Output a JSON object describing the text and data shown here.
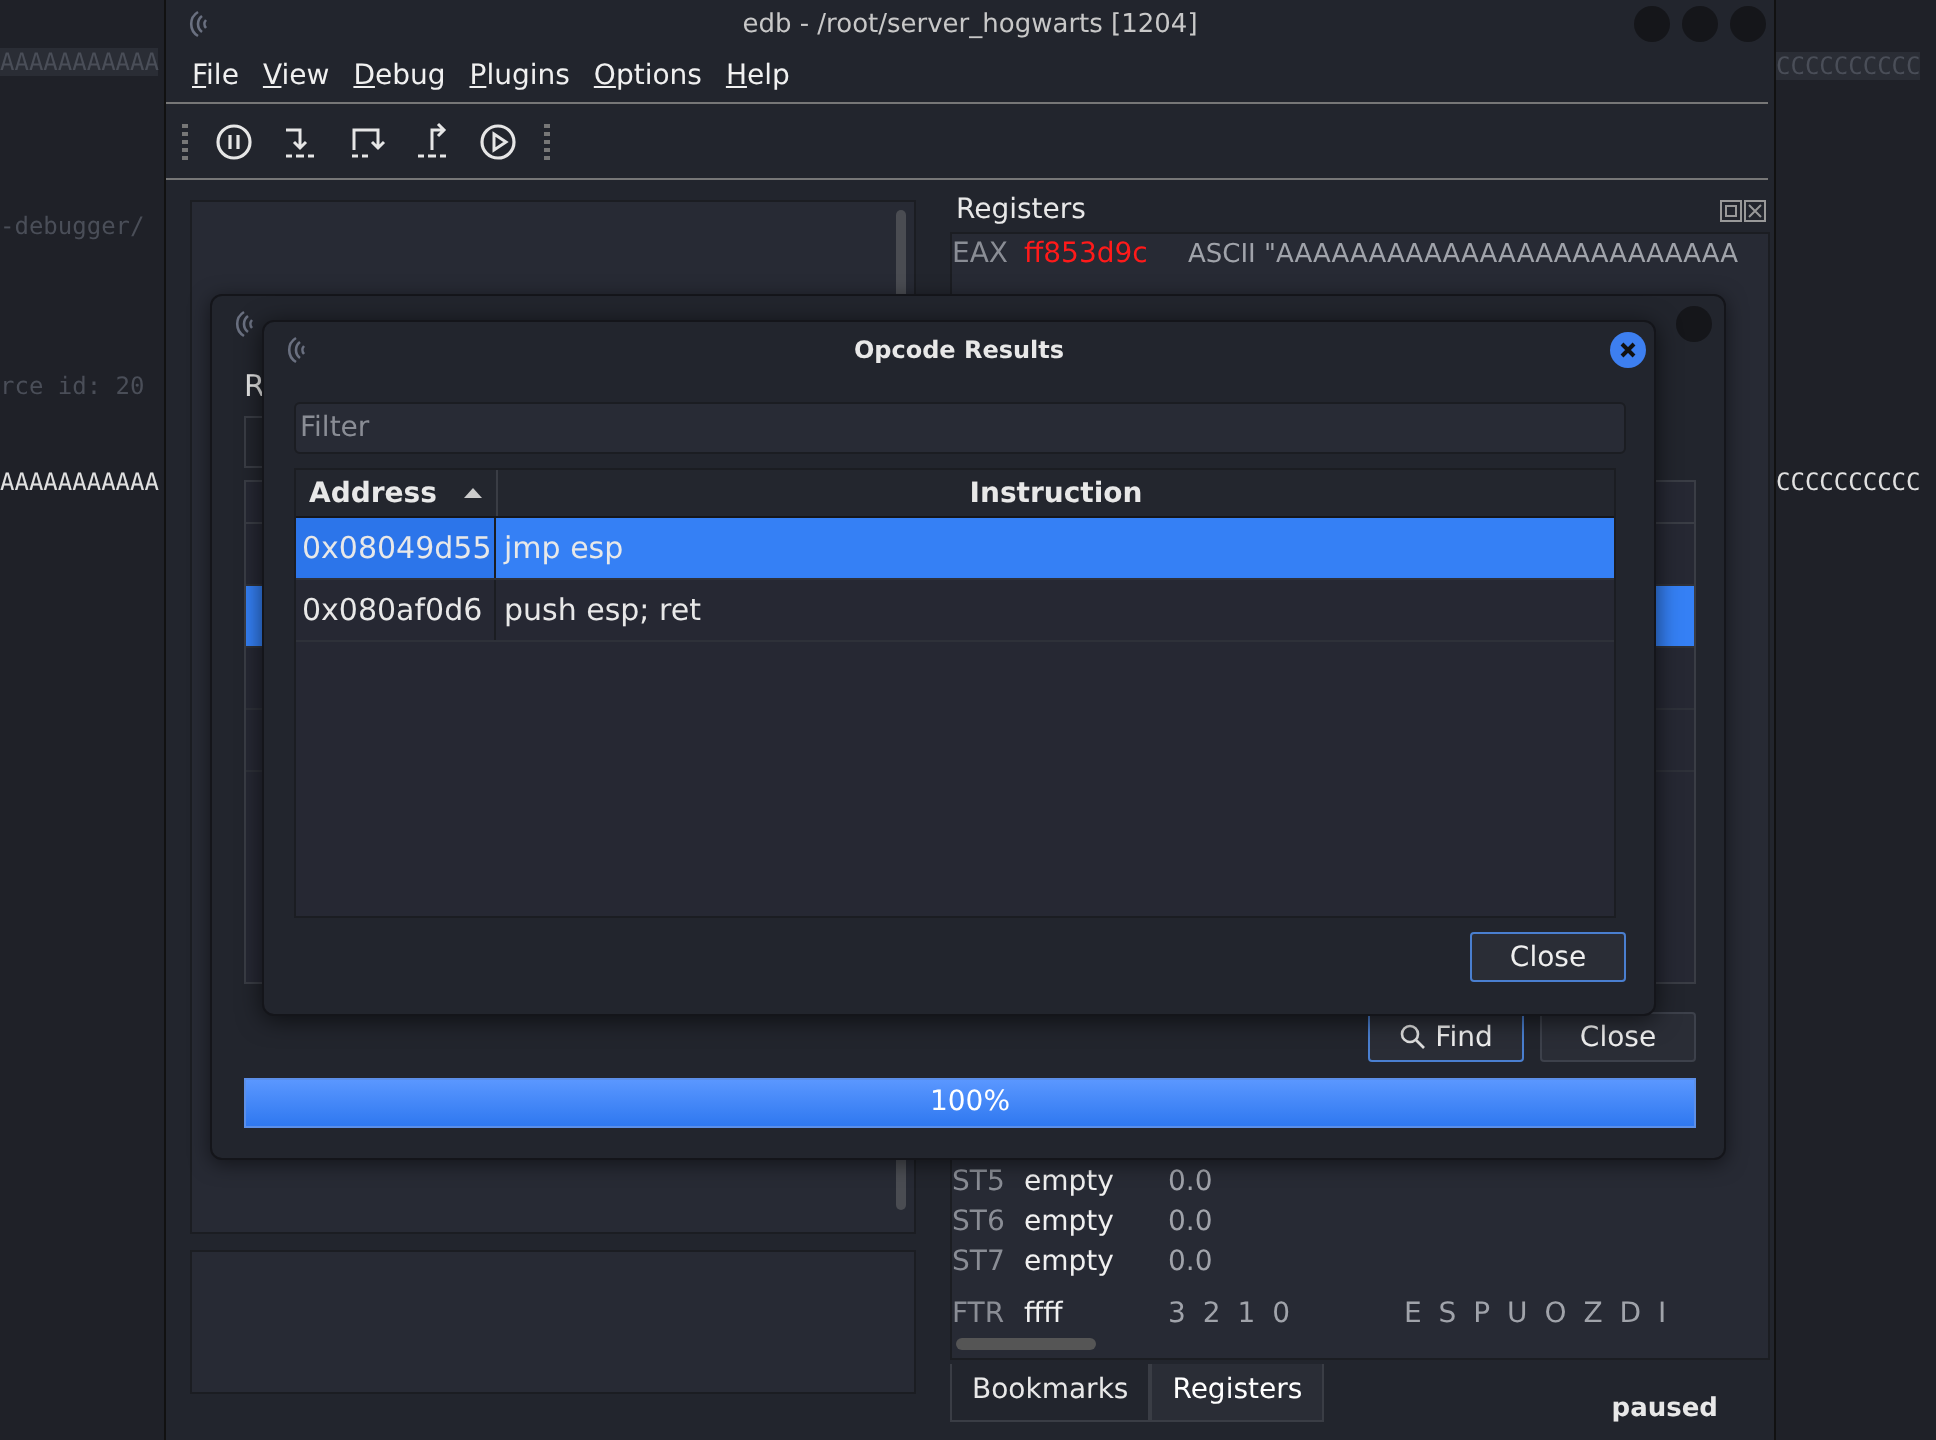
{
  "background_terminal": {
    "left_lines": [
      {
        "text": "AAAAAAAAAAA",
        "kind": "dim"
      },
      {
        "text": "-debugger/",
        "kind": "dim"
      },
      {
        "text": "rce id: 20",
        "kind": "dim"
      },
      {
        "text": "AAAAAAAAAAA",
        "kind": "bright"
      }
    ],
    "right_lines": [
      {
        "text": "CCCCCCCCCC",
        "kind": "dim"
      },
      {
        "text": "CCCCCCCCCC",
        "kind": "bright"
      }
    ]
  },
  "main_window": {
    "title": "edb - /root/server_hogwarts [1204]",
    "menu": [
      "File",
      "View",
      "Debug",
      "Plugins",
      "Options",
      "Help"
    ],
    "registers": {
      "title": "Registers",
      "rows": [
        {
          "name": "EAX",
          "value": "ff853d9c",
          "changed": true,
          "comment": "ASCII \"AAAAAAAAAAAAAAAAAAAAAAAAA"
        }
      ],
      "fpu_rows": [
        {
          "name": "ST5",
          "tag": "empty",
          "value": "0.0"
        },
        {
          "name": "ST6",
          "tag": "empty",
          "value": "0.0"
        },
        {
          "name": "ST7",
          "tag": "empty",
          "value": "0.0"
        }
      ],
      "ftr": {
        "name": "FTR",
        "value": "ffff",
        "bits": "3 2 1 0",
        "flags": "E S P U O Z D I"
      }
    },
    "tabs": [
      {
        "label": "Bookmarks",
        "selected": false
      },
      {
        "label": "Registers",
        "selected": true
      }
    ],
    "status": "paused"
  },
  "opcode_search": {
    "label_fragment": "R",
    "list_rows": [
      {
        "selected": false
      },
      {
        "selected": true
      },
      {
        "selected": false
      },
      {
        "selected": false
      }
    ],
    "find_button": "Find",
    "close_button": "Close",
    "progress": {
      "level": 1,
      "text": "100%"
    }
  },
  "opcode_results": {
    "title": "Opcode Results",
    "filter": {
      "placeholder": "Filter"
    },
    "columns": [
      {
        "label": "Address",
        "sorted": true
      },
      {
        "label": "Instruction",
        "sorted": false
      }
    ],
    "rows": [
      {
        "address": "0x08049d55",
        "instruction": "jmp esp",
        "selected": true
      },
      {
        "address": "0x080af0d6",
        "instruction": "push esp; ret",
        "selected": false
      }
    ],
    "close_button": "Close"
  }
}
